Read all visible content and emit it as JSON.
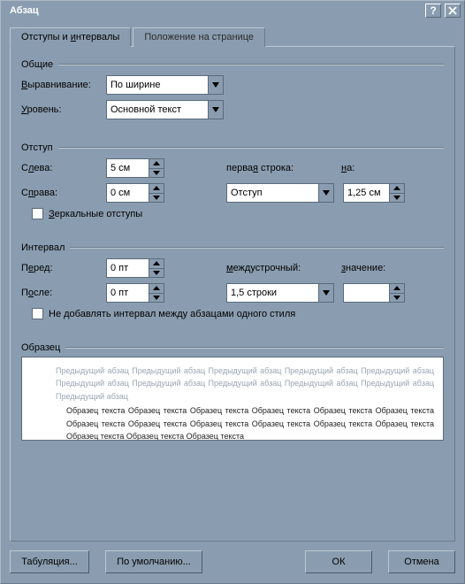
{
  "title": "Абзац",
  "tabs": {
    "indents": "Отступы и интервалы",
    "pageflow": "Положение на странице"
  },
  "general": {
    "legend": "Общие",
    "alignment_label": "Выравнивание:",
    "alignment_value": "По ширине",
    "level_label": "Уровень:",
    "level_value": "Основной текст"
  },
  "indent": {
    "legend": "Отступ",
    "left_label": "Слева:",
    "left_value": "5 см",
    "right_label": "Справа:",
    "right_value": "0 см",
    "firstline_label": "первая строка:",
    "firstline_type": "Отступ",
    "by_label": "на:",
    "by_value": "1,25 см",
    "mirror_label": "Зеркальные отступы"
  },
  "spacing": {
    "legend": "Интервал",
    "before_label": "Перед:",
    "before_value": "0 пт",
    "after_label": "После:",
    "after_value": "0 пт",
    "linespacing_label": "междустрочный:",
    "linespacing_value": "1,5 строки",
    "at_label": "значение:",
    "at_value": "",
    "nospace_label": "Не добавлять интервал между абзацами одного стиля"
  },
  "preview": {
    "legend": "Образец",
    "prev_text": "Предыдущий абзац Предыдущий абзац Предыдущий абзац Предыдущий абзац Предыдущий абзац Предыдущий абзац Предыдущий абзац Предыдущий абзац Предыдущий абзац Предыдущий абзац Предыдущий абзац",
    "sample_text": "Образец текста Образец текста Образец текста Образец текста Образец текста Образец текста Образец текста Образец текста Образец текста Образец текста Образец текста Образец текста Образец текста Образец текста Образец текста"
  },
  "buttons": {
    "tabs": "Табуляция...",
    "default": "По умолчанию...",
    "ok": "ОК",
    "cancel": "Отмена"
  }
}
